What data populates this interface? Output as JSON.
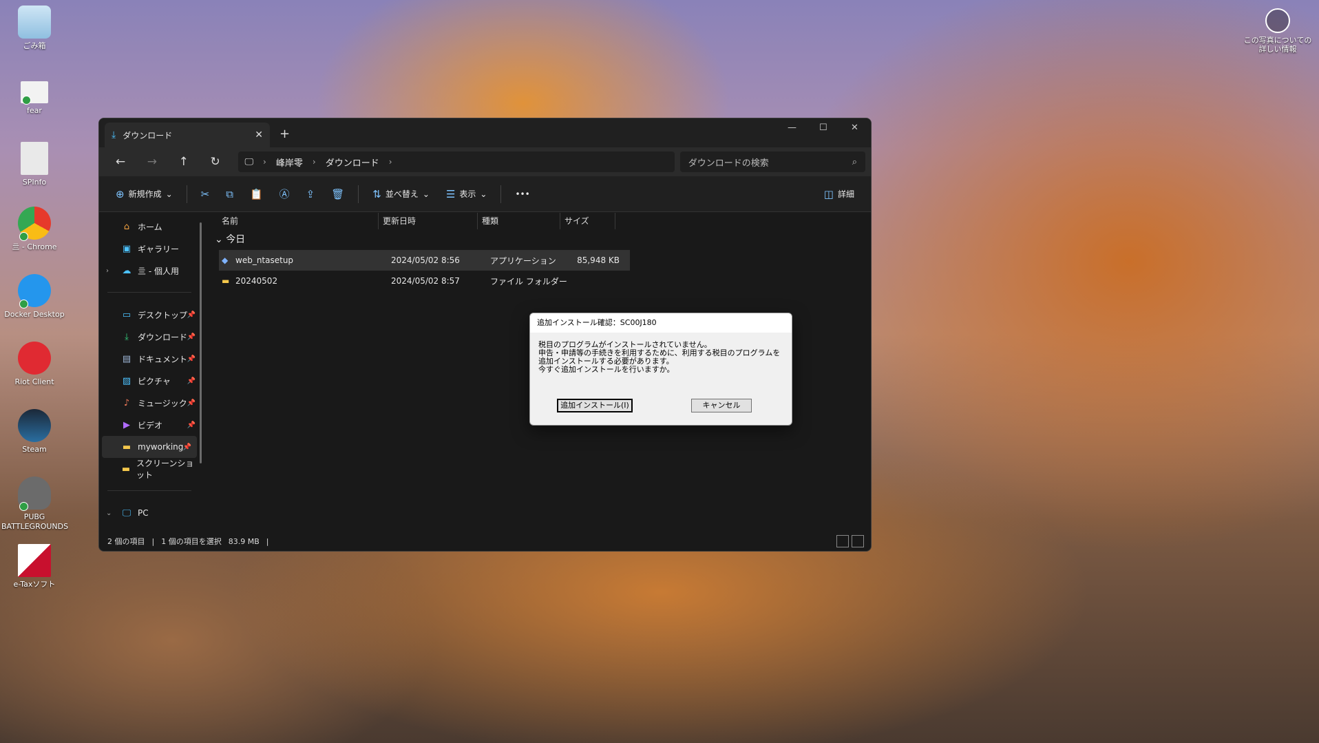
{
  "desktop": {
    "icons": [
      {
        "label": "ごみ箱",
        "icon": "recycle-bin-icon",
        "color": "#6aaed6"
      },
      {
        "label": "fear",
        "icon": "document-icon",
        "color": "#f2f2f2"
      },
      {
        "label": "SPInfo",
        "icon": "settings-file-icon",
        "color": "#e9e9e9"
      },
      {
        "label": "亖 - Chrome",
        "icon": "chrome-icon",
        "color": "#e6392b"
      },
      {
        "label": "Docker Desktop",
        "icon": "docker-icon",
        "color": "#2496ed"
      },
      {
        "label": "Riot Client",
        "icon": "riot-icon",
        "color": "#e02a32"
      },
      {
        "label": "Steam",
        "icon": "steam-icon",
        "color": "#1b2838"
      },
      {
        "label": "PUBG BATTLEGROUNDS",
        "icon": "pubg-icon",
        "color": "#6b6b6b"
      },
      {
        "label": "e-Taxソフト",
        "icon": "etax-icon",
        "color": "#c8102e"
      }
    ],
    "corner_info": "この写真についての詳しい情報"
  },
  "explorer": {
    "tab_title": "ダウンロード",
    "breadcrumb": [
      "峰岸零",
      "ダウンロード"
    ],
    "search_placeholder": "ダウンロードの検索",
    "toolbar": {
      "new": "新規作成",
      "sort": "並べ替え",
      "view": "表示",
      "more": "•••",
      "details": "詳細"
    },
    "sidebar": {
      "home": "ホーム",
      "gallery": "ギャラリー",
      "onedrive": "亖 - 個人用",
      "desktop": "デスクトップ",
      "downloads": "ダウンロード",
      "documents": "ドキュメント",
      "pictures": "ピクチャ",
      "music": "ミュージック",
      "videos": "ビデオ",
      "myworking": "myworking",
      "screenshots": "スクリーンショット",
      "pc": "PC"
    },
    "columns": [
      "名前",
      "更新日時",
      "種類",
      "サイズ"
    ],
    "group": "今日",
    "files": [
      {
        "name": "web_ntasetup",
        "date": "2024/05/02 8:56",
        "type": "アプリケーション",
        "size": "85,948 KB"
      },
      {
        "name": "20240502",
        "date": "2024/05/02 8:57",
        "type": "ファイル フォルダー",
        "size": ""
      }
    ],
    "status": {
      "count": "2 個の項目",
      "selected": "1 個の項目を選択",
      "size": "83.9 MB"
    }
  },
  "dialog": {
    "title": "追加インストール確認：SC00J180",
    "line1": "税目のプログラムがインストールされていません。",
    "line2": "申告・申請等の手続きを利用するために、利用する税目のプログラムを",
    "line3": "追加インストールする必要があります。",
    "line4": "今すぐ追加インストールを行いますか。",
    "install_button": "追加インストール(I)",
    "cancel_button": "キャンセル"
  }
}
